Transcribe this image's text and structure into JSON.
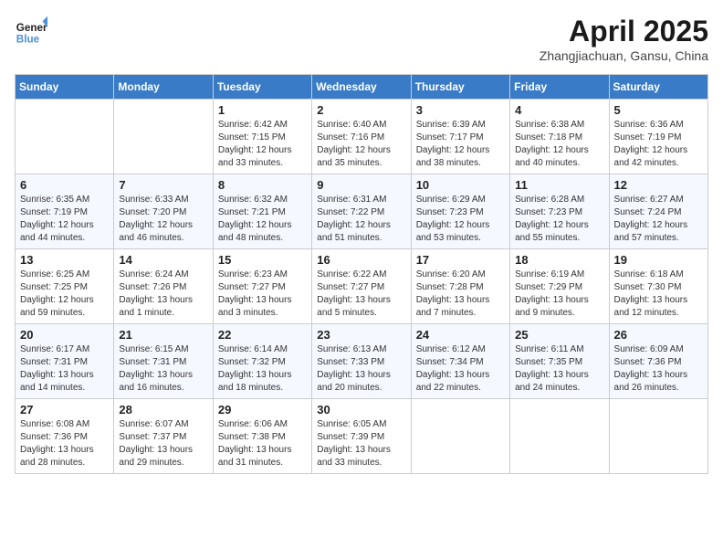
{
  "header": {
    "logo_line1": "General",
    "logo_line2": "Blue",
    "month_title": "April 2025",
    "location": "Zhangjiachuan, Gansu, China"
  },
  "weekdays": [
    "Sunday",
    "Monday",
    "Tuesday",
    "Wednesday",
    "Thursday",
    "Friday",
    "Saturday"
  ],
  "weeks": [
    [
      {
        "day": "",
        "info": ""
      },
      {
        "day": "",
        "info": ""
      },
      {
        "day": "1",
        "info": "Sunrise: 6:42 AM\nSunset: 7:15 PM\nDaylight: 12 hours\nand 33 minutes."
      },
      {
        "day": "2",
        "info": "Sunrise: 6:40 AM\nSunset: 7:16 PM\nDaylight: 12 hours\nand 35 minutes."
      },
      {
        "day": "3",
        "info": "Sunrise: 6:39 AM\nSunset: 7:17 PM\nDaylight: 12 hours\nand 38 minutes."
      },
      {
        "day": "4",
        "info": "Sunrise: 6:38 AM\nSunset: 7:18 PM\nDaylight: 12 hours\nand 40 minutes."
      },
      {
        "day": "5",
        "info": "Sunrise: 6:36 AM\nSunset: 7:19 PM\nDaylight: 12 hours\nand 42 minutes."
      }
    ],
    [
      {
        "day": "6",
        "info": "Sunrise: 6:35 AM\nSunset: 7:19 PM\nDaylight: 12 hours\nand 44 minutes."
      },
      {
        "day": "7",
        "info": "Sunrise: 6:33 AM\nSunset: 7:20 PM\nDaylight: 12 hours\nand 46 minutes."
      },
      {
        "day": "8",
        "info": "Sunrise: 6:32 AM\nSunset: 7:21 PM\nDaylight: 12 hours\nand 48 minutes."
      },
      {
        "day": "9",
        "info": "Sunrise: 6:31 AM\nSunset: 7:22 PM\nDaylight: 12 hours\nand 51 minutes."
      },
      {
        "day": "10",
        "info": "Sunrise: 6:29 AM\nSunset: 7:23 PM\nDaylight: 12 hours\nand 53 minutes."
      },
      {
        "day": "11",
        "info": "Sunrise: 6:28 AM\nSunset: 7:23 PM\nDaylight: 12 hours\nand 55 minutes."
      },
      {
        "day": "12",
        "info": "Sunrise: 6:27 AM\nSunset: 7:24 PM\nDaylight: 12 hours\nand 57 minutes."
      }
    ],
    [
      {
        "day": "13",
        "info": "Sunrise: 6:25 AM\nSunset: 7:25 PM\nDaylight: 12 hours\nand 59 minutes."
      },
      {
        "day": "14",
        "info": "Sunrise: 6:24 AM\nSunset: 7:26 PM\nDaylight: 13 hours\nand 1 minute."
      },
      {
        "day": "15",
        "info": "Sunrise: 6:23 AM\nSunset: 7:27 PM\nDaylight: 13 hours\nand 3 minutes."
      },
      {
        "day": "16",
        "info": "Sunrise: 6:22 AM\nSunset: 7:27 PM\nDaylight: 13 hours\nand 5 minutes."
      },
      {
        "day": "17",
        "info": "Sunrise: 6:20 AM\nSunset: 7:28 PM\nDaylight: 13 hours\nand 7 minutes."
      },
      {
        "day": "18",
        "info": "Sunrise: 6:19 AM\nSunset: 7:29 PM\nDaylight: 13 hours\nand 9 minutes."
      },
      {
        "day": "19",
        "info": "Sunrise: 6:18 AM\nSunset: 7:30 PM\nDaylight: 13 hours\nand 12 minutes."
      }
    ],
    [
      {
        "day": "20",
        "info": "Sunrise: 6:17 AM\nSunset: 7:31 PM\nDaylight: 13 hours\nand 14 minutes."
      },
      {
        "day": "21",
        "info": "Sunrise: 6:15 AM\nSunset: 7:31 PM\nDaylight: 13 hours\nand 16 minutes."
      },
      {
        "day": "22",
        "info": "Sunrise: 6:14 AM\nSunset: 7:32 PM\nDaylight: 13 hours\nand 18 minutes."
      },
      {
        "day": "23",
        "info": "Sunrise: 6:13 AM\nSunset: 7:33 PM\nDaylight: 13 hours\nand 20 minutes."
      },
      {
        "day": "24",
        "info": "Sunrise: 6:12 AM\nSunset: 7:34 PM\nDaylight: 13 hours\nand 22 minutes."
      },
      {
        "day": "25",
        "info": "Sunrise: 6:11 AM\nSunset: 7:35 PM\nDaylight: 13 hours\nand 24 minutes."
      },
      {
        "day": "26",
        "info": "Sunrise: 6:09 AM\nSunset: 7:36 PM\nDaylight: 13 hours\nand 26 minutes."
      }
    ],
    [
      {
        "day": "27",
        "info": "Sunrise: 6:08 AM\nSunset: 7:36 PM\nDaylight: 13 hours\nand 28 minutes."
      },
      {
        "day": "28",
        "info": "Sunrise: 6:07 AM\nSunset: 7:37 PM\nDaylight: 13 hours\nand 29 minutes."
      },
      {
        "day": "29",
        "info": "Sunrise: 6:06 AM\nSunset: 7:38 PM\nDaylight: 13 hours\nand 31 minutes."
      },
      {
        "day": "30",
        "info": "Sunrise: 6:05 AM\nSunset: 7:39 PM\nDaylight: 13 hours\nand 33 minutes."
      },
      {
        "day": "",
        "info": ""
      },
      {
        "day": "",
        "info": ""
      },
      {
        "day": "",
        "info": ""
      }
    ]
  ]
}
